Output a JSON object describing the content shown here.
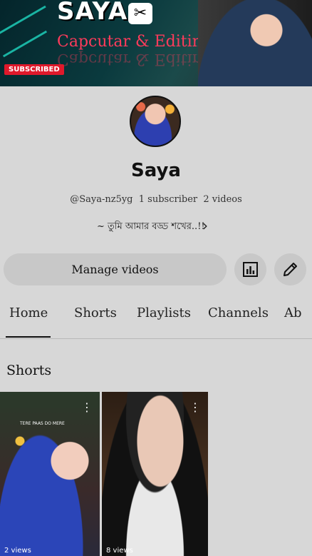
{
  "banner": {
    "title": "SAYA",
    "capcut_logo_glyph": "✂",
    "subtitle": "Capcutar & Editing",
    "subscribed_badge": "SUBSCRIBED"
  },
  "channel": {
    "name": "Saya",
    "handle": "@Saya-nz5yg",
    "subscribers": "1 subscriber",
    "videos": "2 videos",
    "description": "~ তুমি আমার বড্ড শখের..!!",
    "description_chevron": "›"
  },
  "actions": {
    "manage_videos": "Manage videos",
    "analytics_icon": "analytics-icon",
    "edit_icon": "pencil-icon"
  },
  "tabs": [
    {
      "label": "Home",
      "active": true
    },
    {
      "label": "Shorts",
      "active": false
    },
    {
      "label": "Playlists",
      "active": false
    },
    {
      "label": "Channels",
      "active": false
    },
    {
      "label": "Ab",
      "active": false
    }
  ],
  "section": {
    "title": "Shorts"
  },
  "shorts": [
    {
      "caption": "TERE PAAS DO MERE",
      "more": "⋮",
      "views": "2 views"
    },
    {
      "caption": "",
      "more": "⋮",
      "views": "8 views"
    }
  ],
  "colors": {
    "background": "#d7d7d7",
    "button_bg": "#c8c8c8",
    "banner_accent": "#1fd7c0",
    "banner_subtitle": "#ff3b5b",
    "subscribed_red": "#e0192b"
  }
}
